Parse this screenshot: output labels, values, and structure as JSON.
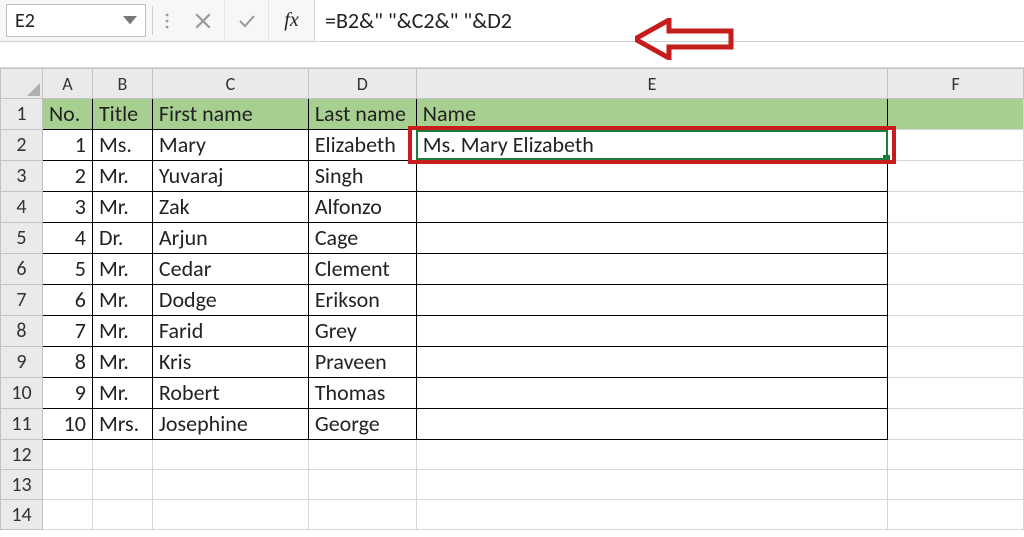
{
  "namebox": {
    "value": "E2"
  },
  "formula": {
    "value": "=B2&\" \"&C2&\" \"&D2"
  },
  "fx_label": "fx",
  "columns": [
    "A",
    "B",
    "C",
    "D",
    "E",
    "F"
  ],
  "row_numbers": [
    1,
    2,
    3,
    4,
    5,
    6,
    7,
    8,
    9,
    10,
    11,
    12,
    13,
    14
  ],
  "headers": {
    "A": "No.",
    "B": "Title",
    "C": "First name",
    "D": "Last name",
    "E": "Name"
  },
  "rows": [
    {
      "no": "1",
      "title": "Ms.",
      "first": "Mary",
      "last": "Elizabeth",
      "name": "Ms. Mary Elizabeth"
    },
    {
      "no": "2",
      "title": "Mr.",
      "first": "Yuvaraj",
      "last": "Singh",
      "name": ""
    },
    {
      "no": "3",
      "title": "Mr.",
      "first": "Zak",
      "last": "Alfonzo",
      "name": ""
    },
    {
      "no": "4",
      "title": "Dr.",
      "first": "Arjun",
      "last": "Cage",
      "name": ""
    },
    {
      "no": "5",
      "title": "Mr.",
      "first": "Cedar",
      "last": "Clement",
      "name": ""
    },
    {
      "no": "6",
      "title": "Mr.",
      "first": "Dodge",
      "last": "Erikson",
      "name": ""
    },
    {
      "no": "7",
      "title": "Mr.",
      "first": "Farid",
      "last": "Grey",
      "name": ""
    },
    {
      "no": "8",
      "title": "Mr.",
      "first": "Kris",
      "last": "Praveen",
      "name": ""
    },
    {
      "no": "9",
      "title": "Mr.",
      "first": "Robert",
      "last": "Thomas",
      "name": ""
    },
    {
      "no": "10",
      "title": "Mrs.",
      "first": "Josephine",
      "last": "George",
      "name": ""
    }
  ],
  "annotation": {
    "color": "#c71c1c"
  }
}
